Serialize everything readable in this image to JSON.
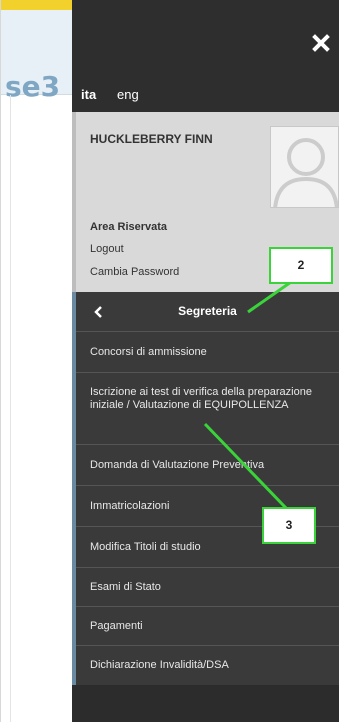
{
  "background": {
    "logo_fragment": "se3"
  },
  "drawer": {
    "languages": [
      {
        "label": "ita",
        "active": true
      },
      {
        "label": "eng",
        "active": false
      }
    ],
    "user": {
      "name": "HUCKLEBERRY FINN",
      "area_label": "Area Riservata",
      "logout": "Logout",
      "change_password": "Cambia Password"
    },
    "menu": {
      "title": "Segreteria",
      "items": [
        {
          "label": "Concorsi di ammissione"
        },
        {
          "label": "Iscrizione ai test di verifica della preparazione iniziale / Valutazione di EQUIPOLLENZA"
        },
        {
          "label": "Domanda di Valutazione Preventiva"
        },
        {
          "label": "Immatricolazioni"
        },
        {
          "label": "Modifica Titoli di studio"
        },
        {
          "label": "Esami di Stato"
        },
        {
          "label": "Pagamenti"
        },
        {
          "label": "Dichiarazione Invalidità/DSA"
        }
      ]
    }
  },
  "annotations": {
    "callout_2": "2",
    "callout_3": "3",
    "color": "#3ad33a"
  },
  "colors": {
    "drawer": "#3a3a3a",
    "user_box": "#d9d9d9",
    "menu_accent": "#6a8aa1",
    "top_bar": "#f2d12c"
  }
}
